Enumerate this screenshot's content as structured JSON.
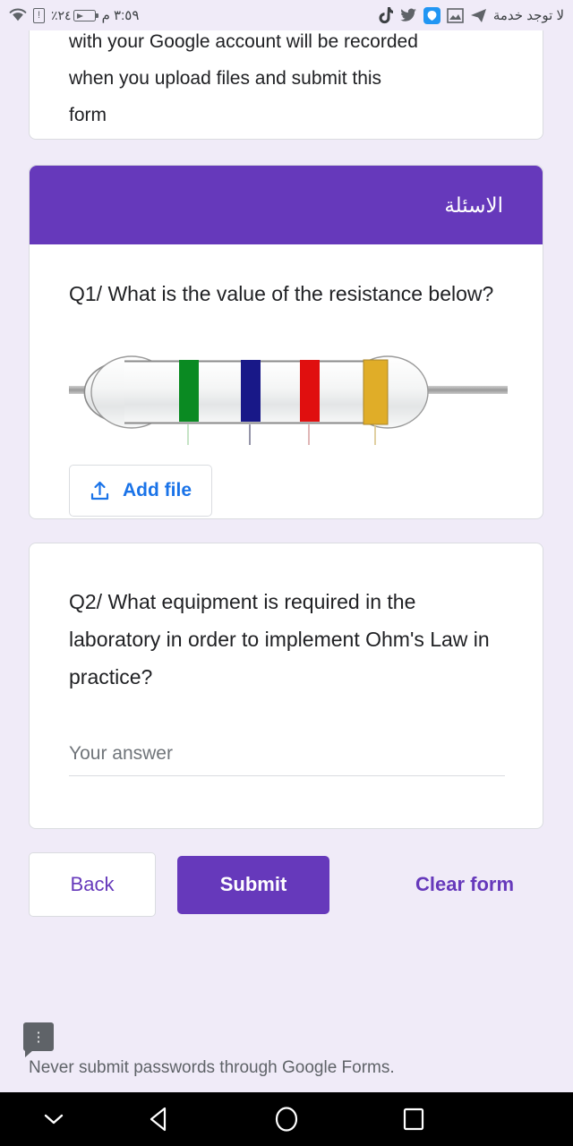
{
  "statusbar": {
    "time": "٣:٥٩ م",
    "battery_percent": "٢٤٪",
    "carrier": "لا توجد خدمة",
    "icons": [
      "wifi-icon",
      "sim-alert-icon",
      "battery-icon",
      "tiktok-icon",
      "twitter-icon",
      "teams-icon",
      "photo-icon",
      "telegram-icon"
    ]
  },
  "description_card": {
    "text_line1": "with your Google account will be recorded",
    "text_line2": "when you upload files and submit this",
    "text_line3": "form"
  },
  "question1": {
    "section_header": "الاسئلة",
    "title": "Q1/ What is the value of the resistance below?",
    "image_alt": "resistor-image",
    "add_file_label": "Add file",
    "add_file_icon": "upload-icon",
    "resistor": {
      "bands": [
        {
          "name": "green",
          "color": "#0a8a22"
        },
        {
          "name": "blue",
          "color": "#181888"
        },
        {
          "name": "red",
          "color": "#e00f0f"
        },
        {
          "name": "gold",
          "color": "#e0ad28"
        }
      ],
      "body_color": "#eceded",
      "lead_color": "#a8a8a8"
    }
  },
  "question2": {
    "title": "Q2/ What equipment is required in the laboratory in order to implement Ohm's Law in practice?",
    "answer_placeholder": "Your answer",
    "answer_value": ""
  },
  "actions": {
    "back_label": "Back",
    "submit_label": "Submit",
    "clear_label": "Clear form",
    "feedback_dots": "⋮"
  },
  "footer": {
    "note": "Never submit passwords through Google Forms."
  },
  "navbar": {
    "hide_keyboard": "chevron-down-icon",
    "back": "back-triangle-icon",
    "home": "home-circle-icon",
    "recents": "recents-square-icon"
  },
  "colors": {
    "page_background": "#f0ebf8",
    "accent_purple": "#6639bb",
    "link_blue": "#1a73e8",
    "card_white": "#ffffff",
    "text_primary": "#202124",
    "text_secondary": "#5f6368"
  }
}
